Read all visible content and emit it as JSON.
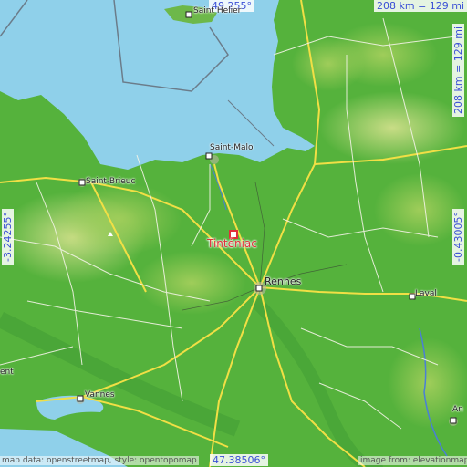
{
  "map": {
    "place": "Tinténiac",
    "coords": {
      "top_lat": "49.255°",
      "bottom_lat": "47.38506°",
      "left_lon": "-3.24255°",
      "right_lon": "-0.43005°"
    },
    "scale": {
      "top": "208 km = 129 mi",
      "right": "208 km = 129 mi"
    },
    "cities": {
      "saint_helier": "Saint Helier",
      "saint_malo": "Saint-Malo",
      "saint_brieuc": "Saint-Brieuc",
      "rennes": "Rennes",
      "laval": "Laval",
      "vannes": "Vannes",
      "lorient_fragment": "ent",
      "angers_fragment": "An"
    },
    "attribution": {
      "left": "map data: openstreetmap, style: opentopomap",
      "right": "image from: elevationmap.info"
    },
    "colors": {
      "sea": "#8fd0ea",
      "lowland": "#4fae3a",
      "upland": "#a9cf63",
      "marker": "#e0303a",
      "coord_text": "#3a4fd6"
    }
  }
}
